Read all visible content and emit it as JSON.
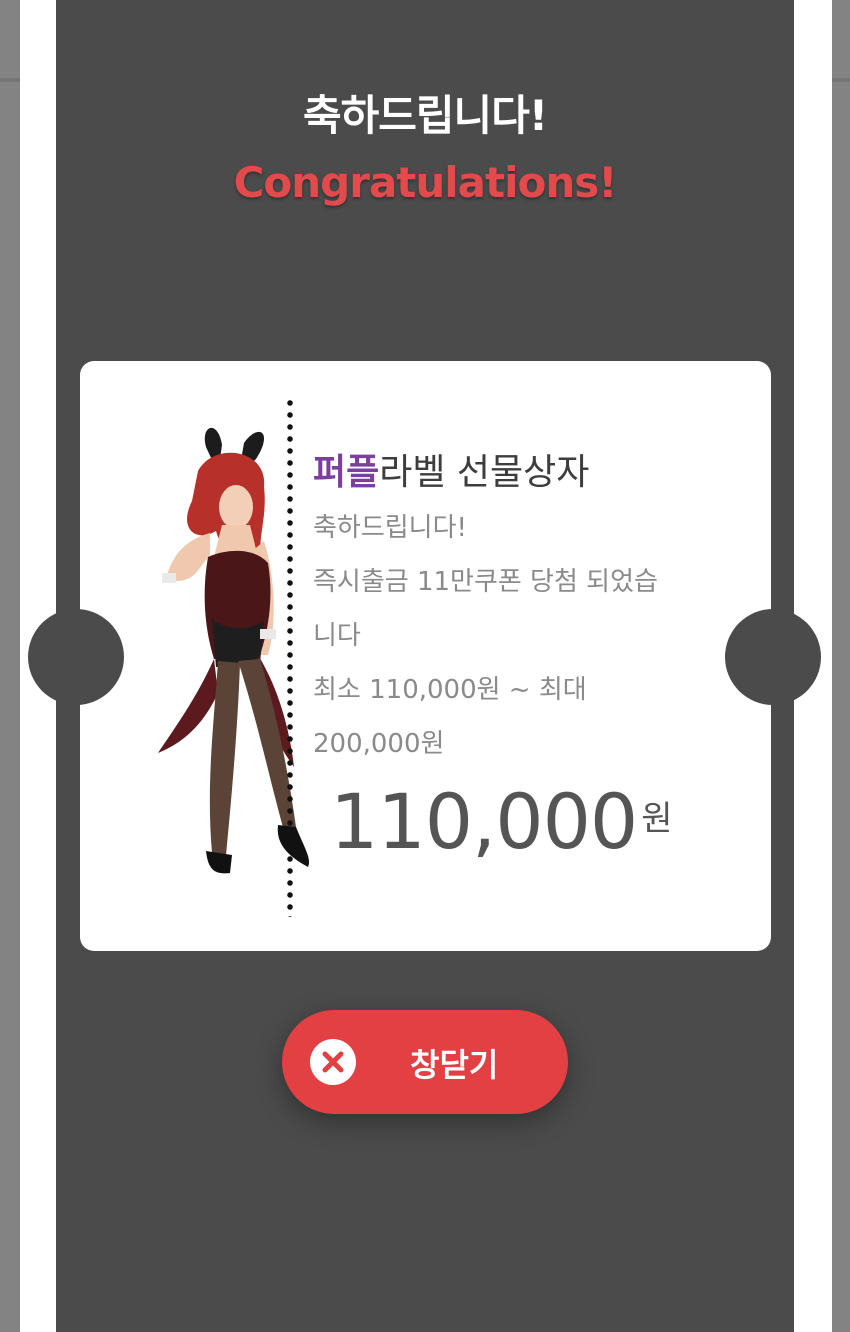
{
  "header": {
    "title_ko": "축하드립니다!",
    "title_en": "Congratulations!"
  },
  "ticket": {
    "brand": "퍼플",
    "title_rest": "라벨 선물상자",
    "message_lines": [
      "축하드립니다!",
      "즉시출금 11만쿠폰 당첨 되었습",
      "니다",
      "최소 110,000원 ~ 최대",
      "200,000원"
    ],
    "amount": "110,000",
    "amount_unit": "원",
    "image_alt": "bunny-girl-character"
  },
  "close_button": {
    "label": "창닫기",
    "icon": "close-icon"
  },
  "colors": {
    "modal_bg": "#4c4b4c",
    "accent_red": "#e24043",
    "brand_purple": "#7a3fa0",
    "title_red": "#e24a4c"
  }
}
